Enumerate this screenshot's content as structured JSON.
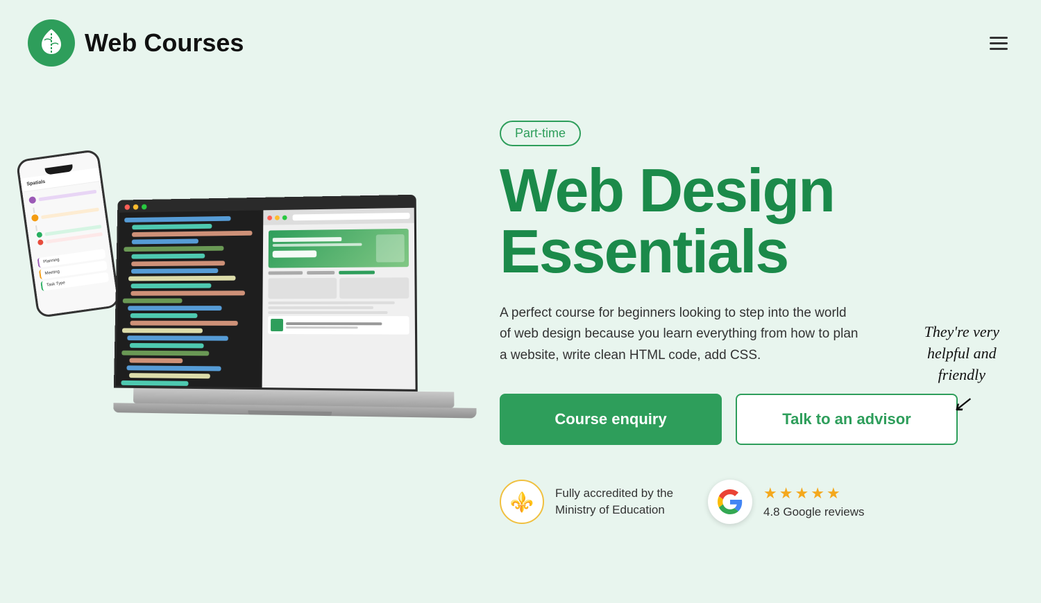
{
  "header": {
    "logo_text": "Web Courses",
    "hamburger_label": "Menu"
  },
  "hero": {
    "badge": "Part-time",
    "title_line1": "Web Design",
    "title_line2": "Essentials",
    "description": "A perfect course for beginners looking to step into the world of web design because you learn everything from how to plan a website, write clean HTML code, add CSS.",
    "testimonial": "They're very\nhelpful and\nfriendly",
    "btn_enquiry": "Course enquiry",
    "btn_advisor": "Talk to an advisor"
  },
  "trust": {
    "ministry_text": "Fully accredited by the\nMinistry of Education",
    "google_rating": "4.8 Google reviews",
    "stars": 5
  }
}
